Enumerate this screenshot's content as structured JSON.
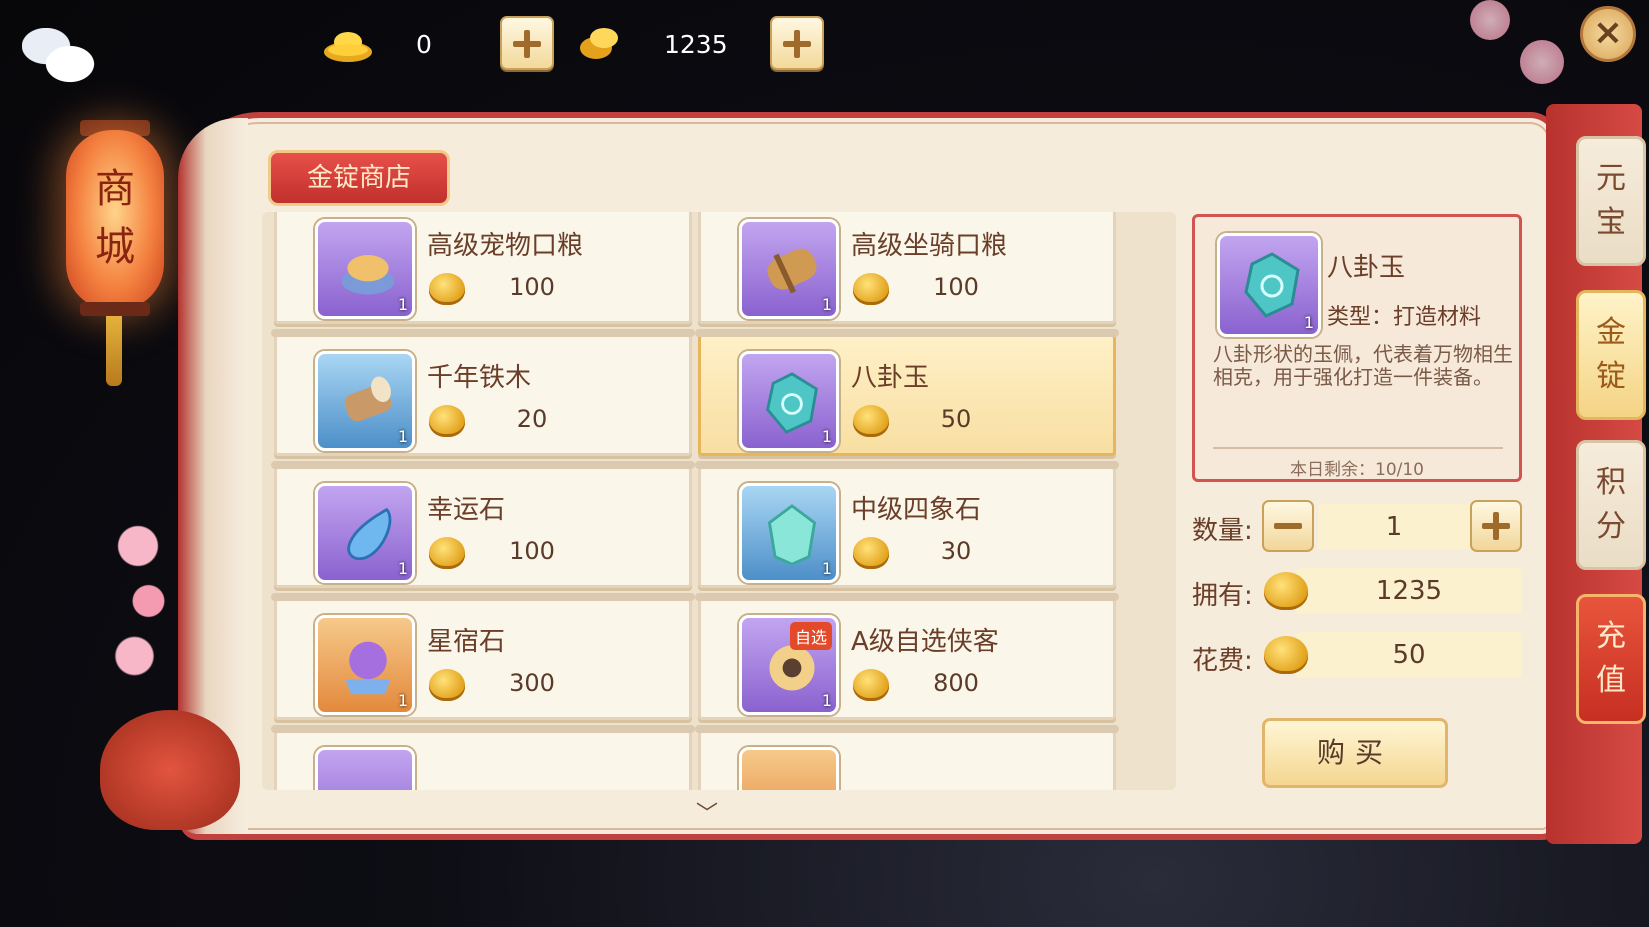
{
  "top_bar": {
    "ingot_count": "0",
    "gold_count": "1235",
    "add_ingot_icon": "plus-icon",
    "add_gold_icon": "plus-icon",
    "close_icon": "close-icon"
  },
  "lantern": {
    "text_line1": "商",
    "text_line2": "城"
  },
  "shop": {
    "title": "金锭商店",
    "items": [
      {
        "name": "高级宠物口粮",
        "price": "100",
        "qty": "1",
        "rarity": "purple",
        "icon": "pet-food-icon"
      },
      {
        "name": "高级坐骑口粮",
        "price": "100",
        "qty": "1",
        "rarity": "purple",
        "icon": "mount-food-icon"
      },
      {
        "name": "千年铁木",
        "price": "20",
        "qty": "1",
        "rarity": "blue",
        "icon": "ironwood-icon"
      },
      {
        "name": "八卦玉",
        "price": "50",
        "qty": "1",
        "rarity": "purple",
        "icon": "bagua-jade-icon",
        "selected": true
      },
      {
        "name": "幸运石",
        "price": "100",
        "qty": "1",
        "rarity": "purple",
        "icon": "luck-stone-icon"
      },
      {
        "name": "中级四象石",
        "price": "30",
        "qty": "1",
        "rarity": "blue",
        "icon": "four-symbols-stone-icon"
      },
      {
        "name": "星宿石",
        "price": "300",
        "qty": "1",
        "rarity": "orange",
        "icon": "star-stone-icon"
      },
      {
        "name": "A级自选侠客",
        "price": "800",
        "qty": "1",
        "rarity": "purple",
        "icon": "hero-select-icon",
        "badge": "自选"
      }
    ]
  },
  "detail": {
    "name": "八卦玉",
    "qty": "1",
    "type": "类型：打造材料",
    "description": "八卦形状的玉佩，代表着万物相生相克，用于强化打造一件装备。",
    "remaining": "本日剩余：10/10"
  },
  "purchase": {
    "quantity_label": "数量:",
    "quantity": "1",
    "owned_label": "拥有:",
    "owned": "1235",
    "cost_label": "花费:",
    "cost": "50",
    "buy_label": "购买"
  },
  "tabs": [
    {
      "label": "元宝"
    },
    {
      "label": "金锭",
      "active": true
    },
    {
      "label": "积分"
    },
    {
      "label": "充值"
    }
  ],
  "colors": {
    "panel_border": "#c0413e",
    "rarity_purple": "#8a62cf",
    "rarity_blue": "#4d8fc9",
    "rarity_orange": "#e3893c",
    "selected_card": "#f8dfa2"
  }
}
